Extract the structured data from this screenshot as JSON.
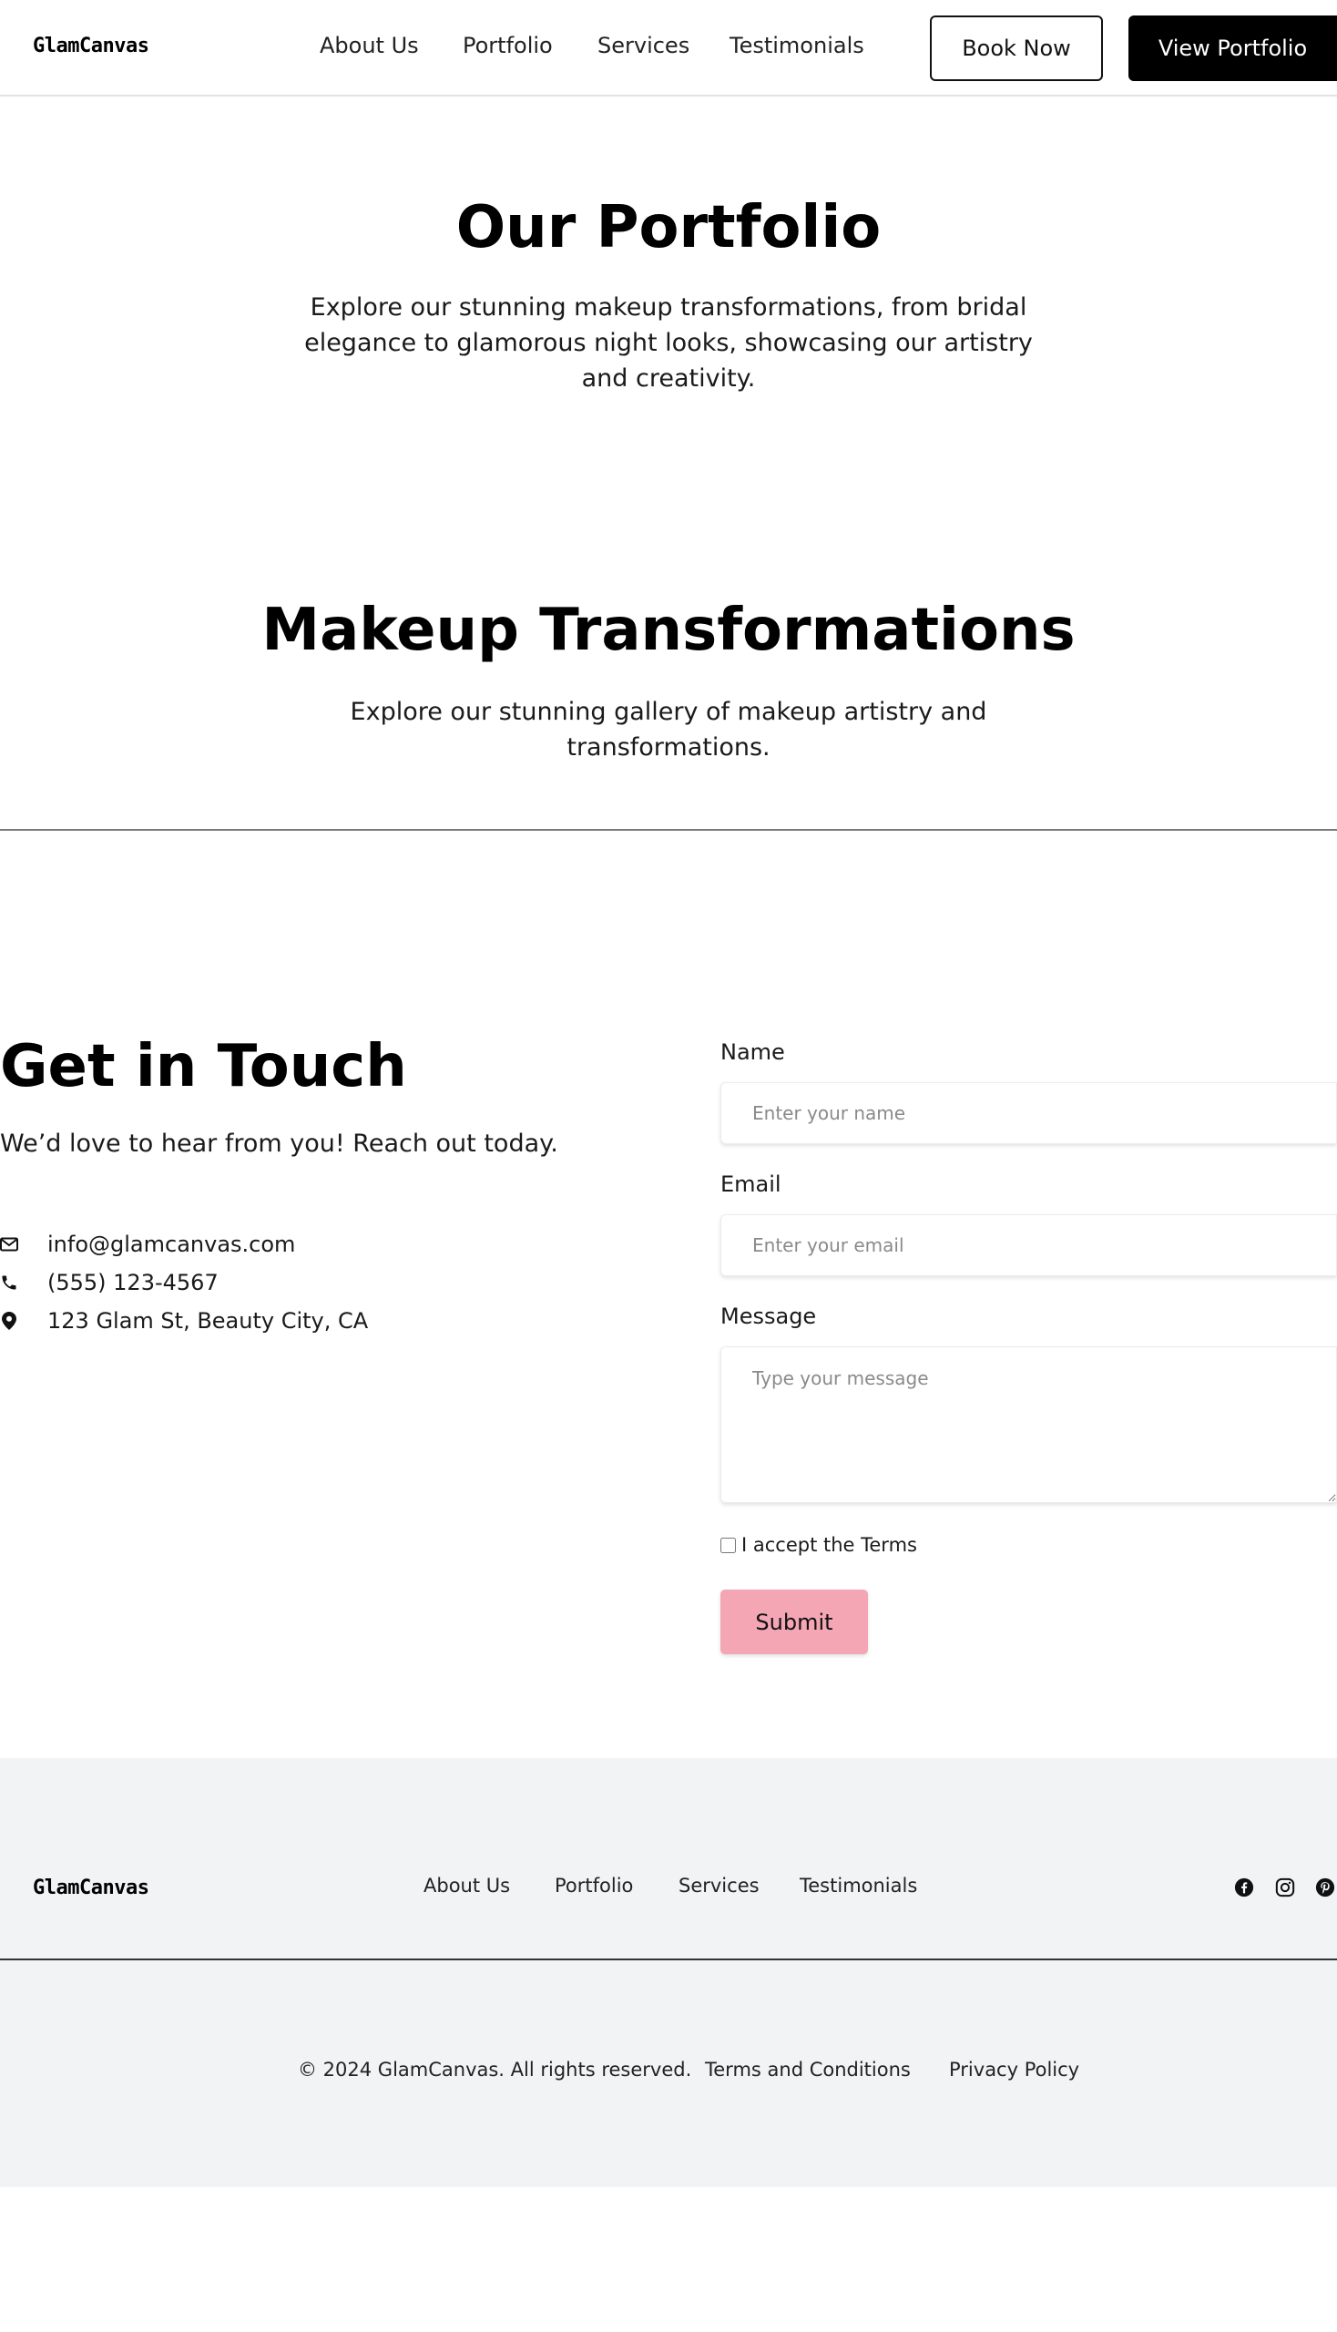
{
  "brand": "GlamCanvas",
  "nav": {
    "links": [
      "About Us",
      "Portfolio",
      "Services",
      "Testimonials"
    ],
    "book_label": "Book Now",
    "portfolio_label": "View Portfolio"
  },
  "portfolio_section": {
    "title": "Our Portfolio",
    "subtitle": "Explore our stunning makeup transformations, from bridal elegance to glamorous night looks, showcasing our artistry and creativity."
  },
  "transformations_section": {
    "title": "Makeup Transformations",
    "subtitle": "Explore our stunning gallery of makeup artistry and transformations."
  },
  "contact": {
    "title": "Get in Touch",
    "subtitle": "We’d love to hear from you! Reach out today.",
    "email": "info@glamcanvas.com",
    "phone": "(555) 123-4567",
    "address": "123 Glam St, Beauty City, CA",
    "form": {
      "name_label": "Name",
      "name_placeholder": "Enter your name",
      "email_label": "Email",
      "email_placeholder": "Enter your email",
      "message_label": "Message",
      "message_placeholder": "Type your message",
      "terms_label": "I accept the Terms",
      "terms_checked": false,
      "submit_label": "Submit"
    }
  },
  "footer": {
    "links": [
      "About Us",
      "Portfolio",
      "Services",
      "Testimonials"
    ],
    "social_icons": [
      "facebook-icon",
      "instagram-icon",
      "pinterest-icon"
    ],
    "copyright": "© 2024 GlamCanvas. All rights reserved.",
    "terms_label": "Terms and Conditions",
    "privacy_label": "Privacy Policy"
  },
  "colors": {
    "accent_pink": "#f4a6b4",
    "footer_bg": "#f2f3f5",
    "primary": "#000000"
  }
}
